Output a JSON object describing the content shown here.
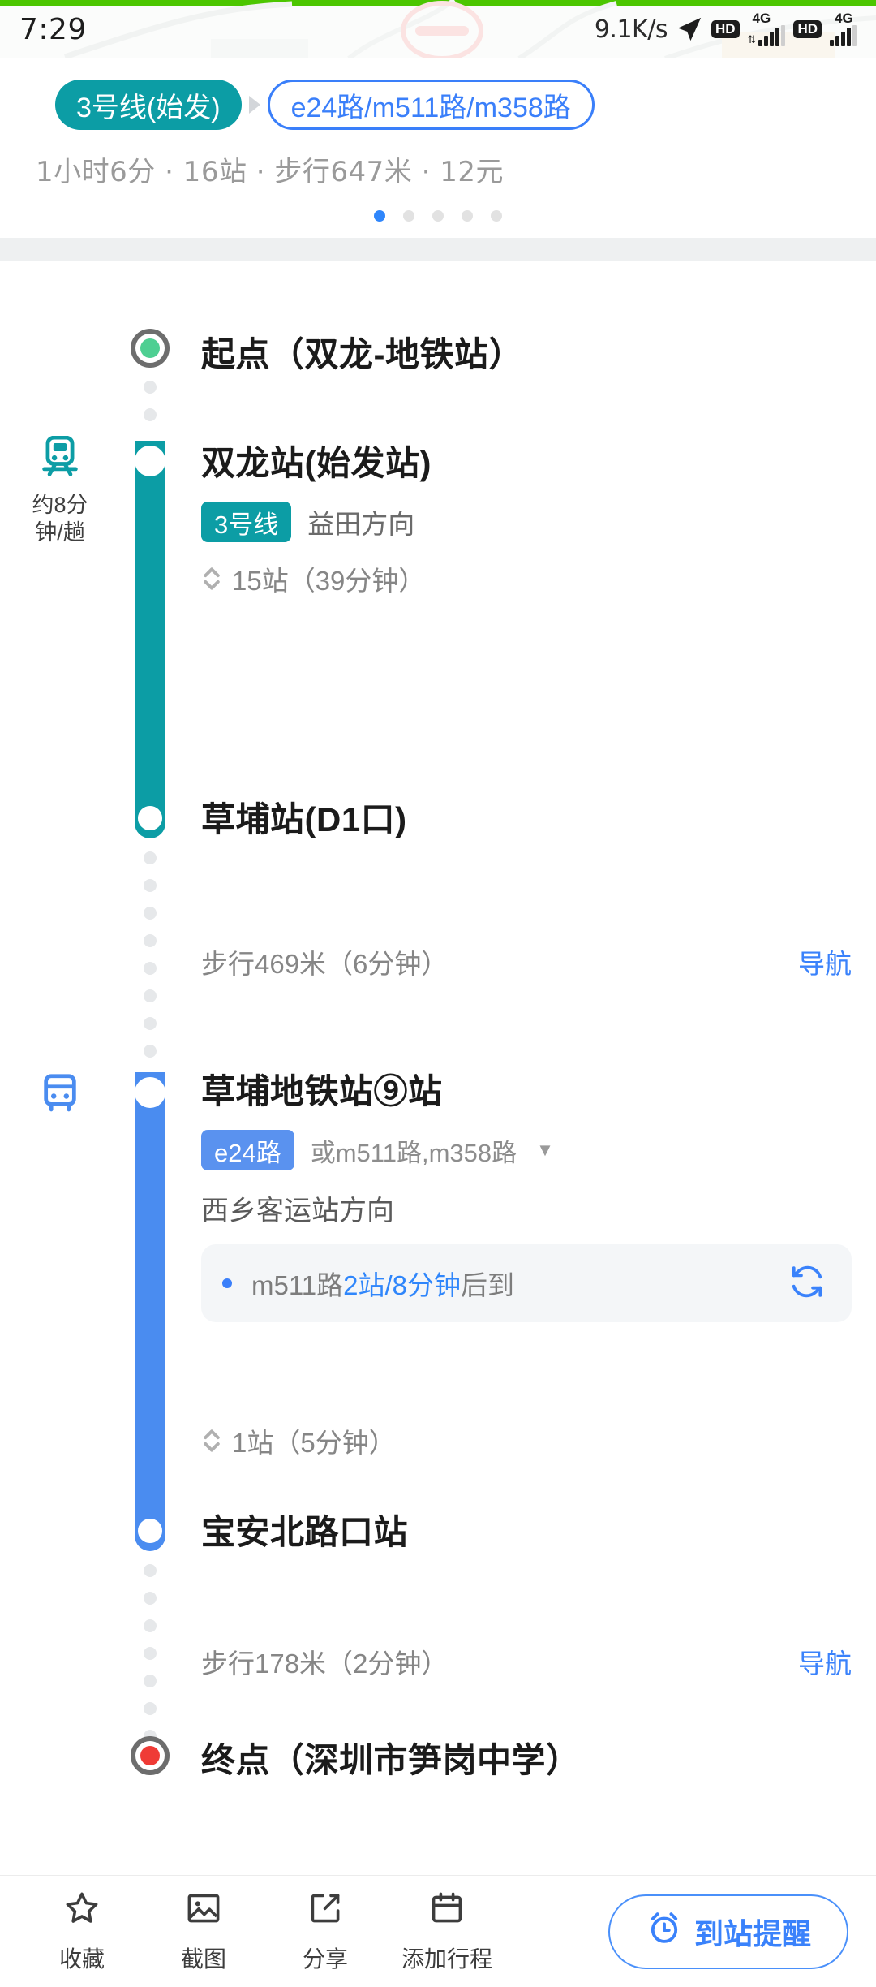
{
  "statusbar": {
    "time": "7:29",
    "network_speed": "9.1K/s",
    "location_icon": "navigation-arrow-icon",
    "hd1_label": "HD",
    "sig1_label": "4G",
    "hd2_label": "HD",
    "sig2_label": "4G"
  },
  "header": {
    "metro_pill": "3号线(始发)",
    "bus_pill": "e24路/m511路/m358路",
    "summary": "1小时6分 · 16站 · 步行647米 · 12元",
    "pager": {
      "total": 5,
      "active": 1,
      "active_color": "#2f86fb",
      "inactive_color": "#e2e2e2"
    }
  },
  "route": {
    "start": {
      "label": "起点（双龙-地铁站）",
      "marker_color": "#4ecf92"
    },
    "metro_segment": {
      "gutter_freq": "约8分\n钟/趟",
      "gutter_icon": "metro-train-icon",
      "board_stop": "双龙站(始发站)",
      "line_badge": "3号线",
      "line_color": "#0c9da5",
      "direction": "益田方向",
      "ride_info": "15站（39分钟）",
      "alight_stop": "草埔站(D1口)"
    },
    "walk1": {
      "text": "步行469米（6分钟）",
      "nav_label": "导航"
    },
    "bus_segment": {
      "gutter_icon": "bus-icon",
      "board_stop": "草埔地铁站⑨站",
      "line_badge": "e24路",
      "line_color": "#5a92ef",
      "alternatives": "或m511路,m358路",
      "alternatives_caret": "▼",
      "direction": "西乡客运站方向",
      "arrival_prefix": "m511路",
      "arrival_highlight": "2站/8分钟",
      "arrival_suffix": "后到",
      "refresh_icon": "refresh-icon",
      "ride_info": "1站（5分钟）",
      "alight_stop": "宝安北路口站"
    },
    "walk2": {
      "text": "步行178米（2分钟）",
      "nav_label": "导航"
    },
    "end": {
      "label": "终点（深圳市笋岗中学）",
      "marker_color": "#ef3b36"
    }
  },
  "bottombar": {
    "tools": [
      {
        "icon": "star-icon",
        "label": "收藏"
      },
      {
        "icon": "image-icon",
        "label": "截图"
      },
      {
        "icon": "share-icon",
        "label": "分享"
      },
      {
        "icon": "calendar-icon",
        "label": "添加行程"
      }
    ],
    "alarm_button": {
      "icon": "alarm-clock-icon",
      "label": "到站提醒",
      "color": "#3a82fb"
    }
  }
}
